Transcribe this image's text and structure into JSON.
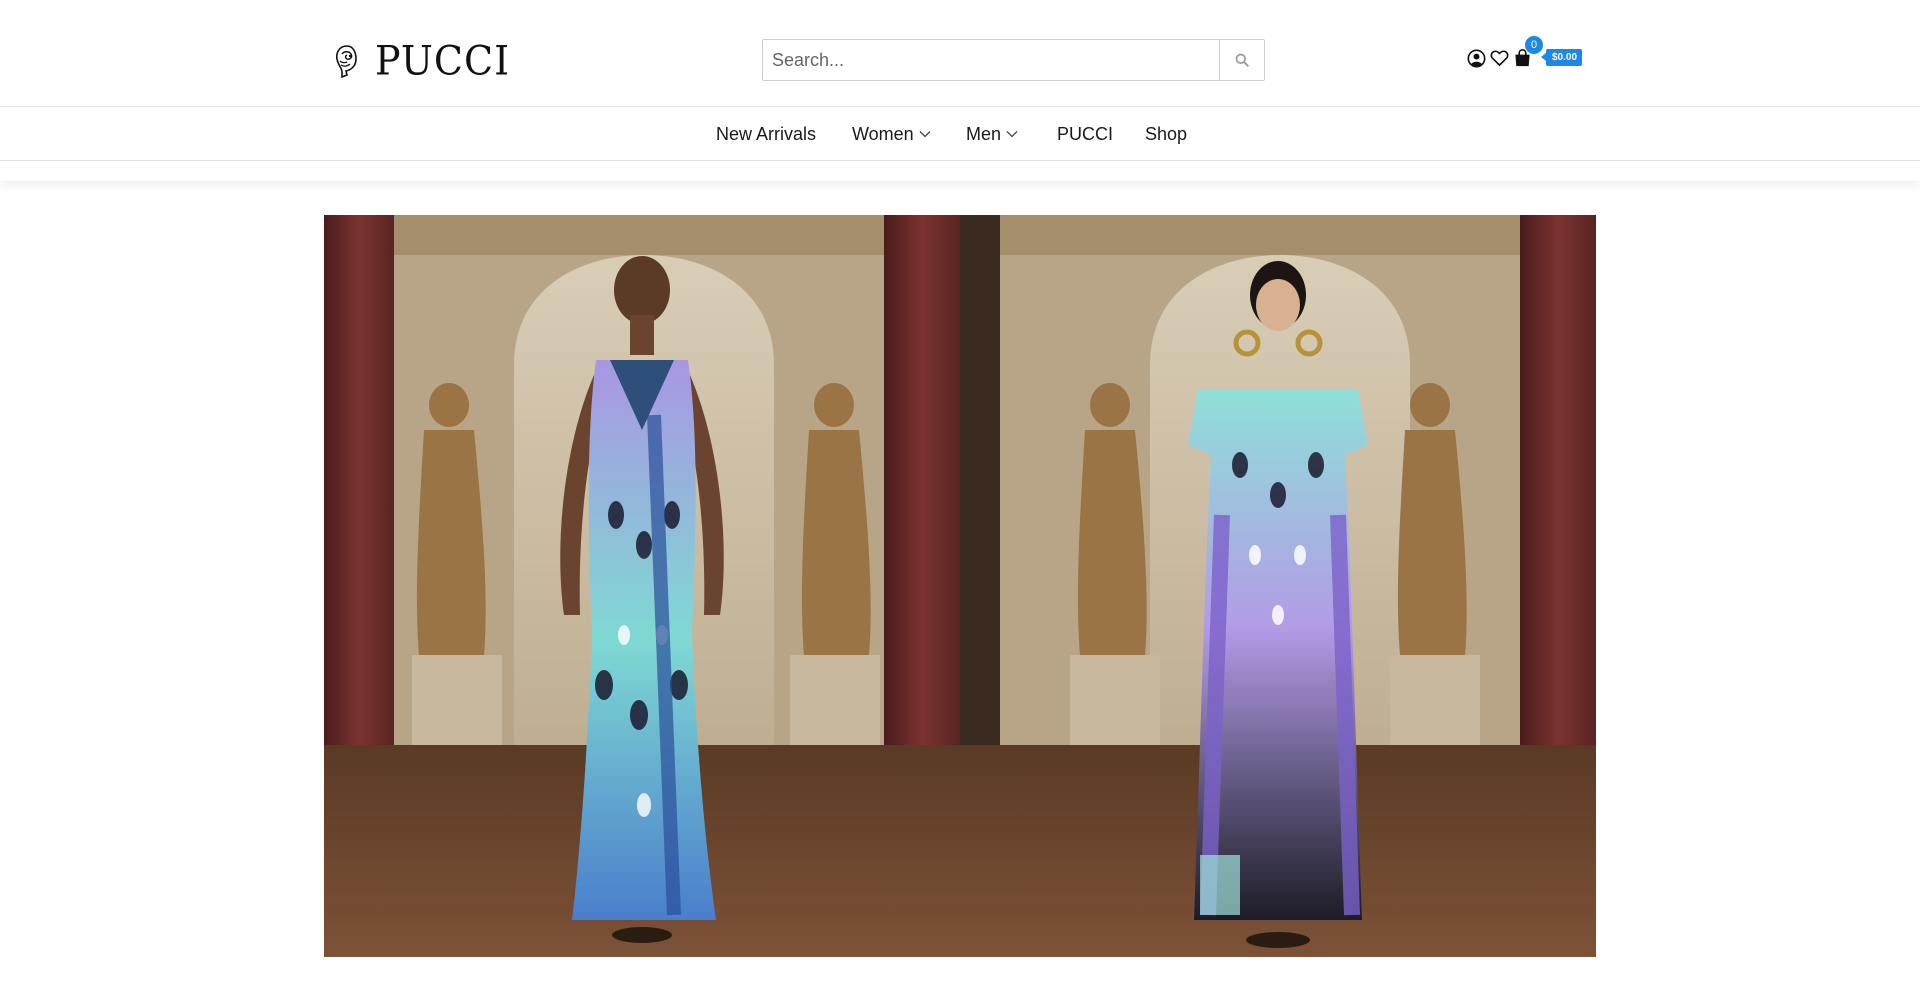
{
  "brand": {
    "name": "PUCCI",
    "logo_icon": "pucci-medallion-icon"
  },
  "search": {
    "placeholder": "Search...",
    "icon": "search-icon"
  },
  "header_icons": {
    "account": "user-icon",
    "wishlist": "heart-icon",
    "cart": "shopping-bag-icon"
  },
  "cart": {
    "count": "0",
    "total": "$0.00"
  },
  "nav": {
    "items": [
      {
        "label": "New Arrivals",
        "has_dropdown": false
      },
      {
        "label": "Women",
        "has_dropdown": true
      },
      {
        "label": "Men",
        "has_dropdown": true
      },
      {
        "label": "PUCCI",
        "has_dropdown": false
      },
      {
        "label": "Shop",
        "has_dropdown": false
      }
    ]
  },
  "hero": {
    "images": [
      {
        "name": "runway-model-sleeveless-print-gown"
      },
      {
        "name": "runway-model-short-sleeve-print-dress"
      }
    ]
  },
  "colors": {
    "accent": "#1e88e5",
    "print_lilac": "#b9a0e6",
    "print_aqua": "#7fdfd6",
    "print_blue": "#3a73c9",
    "background": "#ffffff"
  }
}
